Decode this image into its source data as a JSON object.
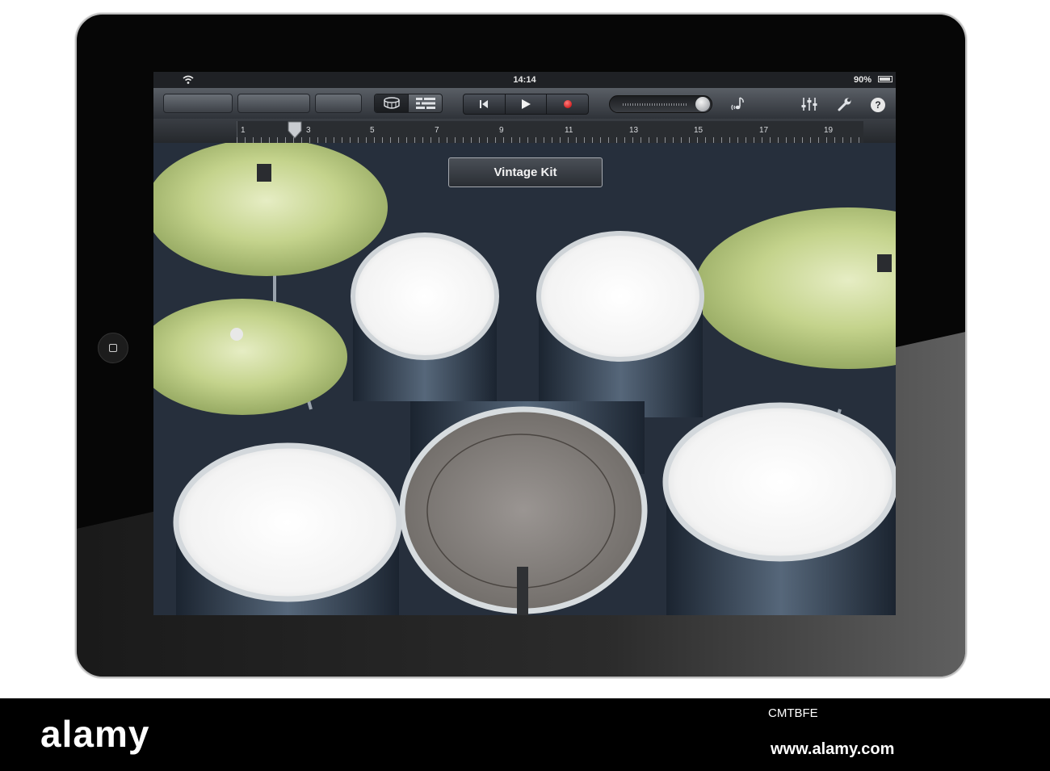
{
  "status_bar": {
    "time": "14:14",
    "battery": "90%"
  },
  "toolbar": {
    "view_buttons": [
      "drum-kit-view-icon",
      "tracks-view-icon"
    ],
    "transport": [
      "rewind-icon",
      "play-icon",
      "record-icon"
    ],
    "volume_level": 0.9,
    "help_label": "?"
  },
  "ruler": {
    "bars": [
      "1",
      "3",
      "5",
      "7",
      "9",
      "11",
      "13",
      "15",
      "17",
      "19"
    ],
    "playhead_bar": 2.8,
    "add_label": "+"
  },
  "instrument": {
    "kit_name": "Vintage Kit"
  },
  "caption": {
    "brand": "alamy",
    "image_code": "CMTBFE",
    "url": "www.alamy.com"
  },
  "colors": {
    "record": "#d40000",
    "cymbal": "#c6d68e",
    "drum_head": "#f3f3f3"
  }
}
